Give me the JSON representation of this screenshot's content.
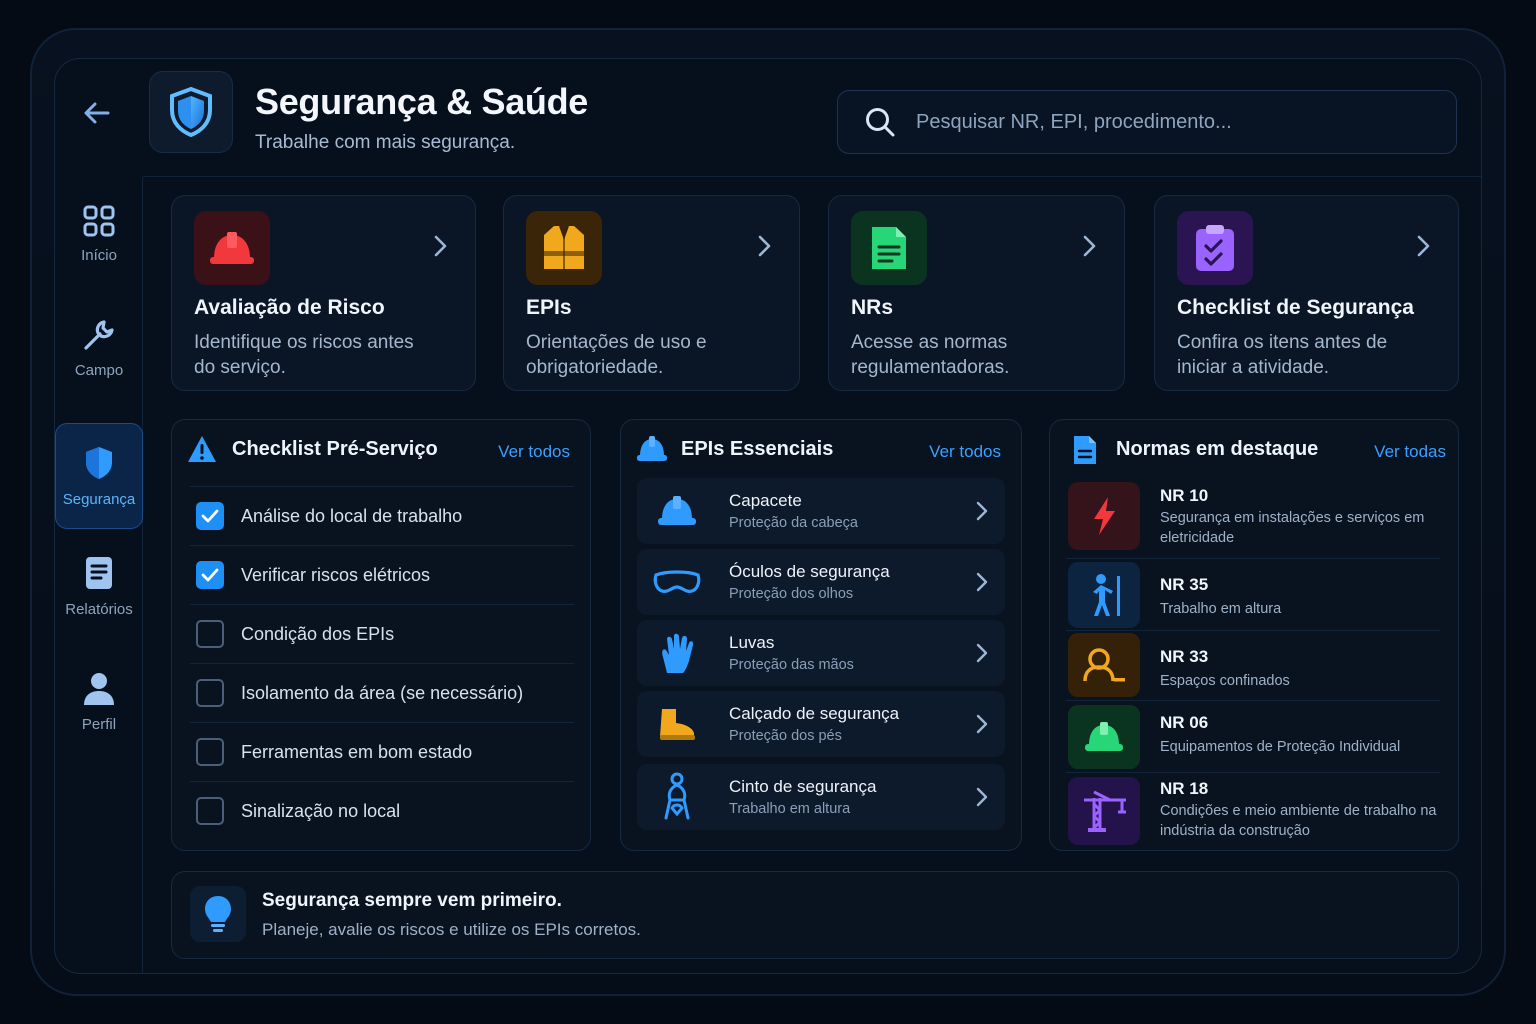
{
  "header": {
    "title": "Segurança & Saúde",
    "subtitle": "Trabalhe com mais segurança.",
    "search_placeholder": "Pesquisar NR, EPI, procedimento..."
  },
  "sidebar": {
    "items": [
      {
        "label": "Início",
        "icon": "grid-icon"
      },
      {
        "label": "Campo",
        "icon": "wrench-icon"
      },
      {
        "label": "Segurança",
        "icon": "shield-icon",
        "active": true
      },
      {
        "label": "Relatórios",
        "icon": "report-icon"
      },
      {
        "label": "Perfil",
        "icon": "user-icon"
      }
    ]
  },
  "cards": [
    {
      "title": "Avaliação de Risco",
      "desc": "Identifique os riscos antes do serviço.",
      "icon": "hard-hat-icon",
      "color": "#e3342f"
    },
    {
      "title": "EPIs",
      "desc": "Orientações de uso e obrigatoriedade.",
      "icon": "vest-icon",
      "color": "#f0a020"
    },
    {
      "title": "NRs",
      "desc": "Acesse as normas regulamentadoras.",
      "icon": "document-icon",
      "color": "#22c55e"
    },
    {
      "title": "Checklist de Segurança",
      "desc": "Confira os itens antes de iniciar a atividade.",
      "icon": "clipboard-check-icon",
      "color": "#8b5cf6"
    }
  ],
  "checklist": {
    "title": "Checklist Pré-Serviço",
    "link": "Ver todos",
    "items": [
      {
        "label": "Análise do local de trabalho",
        "checked": true
      },
      {
        "label": "Verificar riscos elétricos",
        "checked": true
      },
      {
        "label": "Condição dos EPIs",
        "checked": false
      },
      {
        "label": "Isolamento da área (se necessário)",
        "checked": false
      },
      {
        "label": "Ferramentas em bom estado",
        "checked": false
      },
      {
        "label": "Sinalização no local",
        "checked": false
      }
    ]
  },
  "epis": {
    "title": "EPIs Essenciais",
    "link": "Ver todos",
    "items": [
      {
        "name": "Capacete",
        "desc": "Proteção da cabeça",
        "icon": "helmet-icon"
      },
      {
        "name": "Óculos de segurança",
        "desc": "Proteção dos olhos",
        "icon": "goggles-icon"
      },
      {
        "name": "Luvas",
        "desc": "Proteção das mãos",
        "icon": "glove-icon"
      },
      {
        "name": "Calçado de segurança",
        "desc": "Proteção dos pés",
        "icon": "boot-icon"
      },
      {
        "name": "Cinto de segurança",
        "desc": "Trabalho em altura",
        "icon": "harness-icon"
      }
    ]
  },
  "normas": {
    "title": "Normas em destaque",
    "link": "Ver todas",
    "items": [
      {
        "code": "NR 10",
        "desc": "Segurança em instalações e serviços em eletricidade",
        "icon": "lightning-icon",
        "color": "#e3342f"
      },
      {
        "code": "NR 35",
        "desc": "Trabalho em altura",
        "icon": "worker-height-icon",
        "color": "#2b9bff"
      },
      {
        "code": "NR 33",
        "desc": "Espaços confinados",
        "icon": "confined-space-icon",
        "color": "#f0a020"
      },
      {
        "code": "NR 06",
        "desc": "Equipamentos de Proteção Individual",
        "icon": "helmet-icon",
        "color": "#22c55e"
      },
      {
        "code": "NR 18",
        "desc": "Condições e meio ambiente de trabalho na indústria da construção",
        "icon": "crane-icon",
        "color": "#8b5cf6"
      }
    ]
  },
  "tip": {
    "title": "Segurança sempre vem primeiro.",
    "desc": "Planeje, avalie os riscos e utilize os EPIs corretos.",
    "icon": "lightbulb-icon"
  }
}
